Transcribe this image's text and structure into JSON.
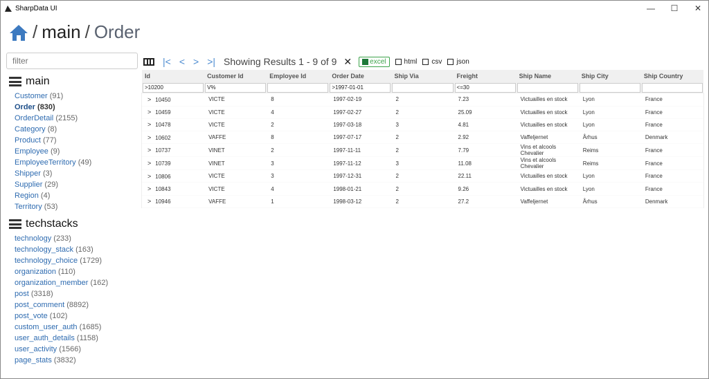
{
  "app": {
    "title": "SharpData UI"
  },
  "breadcrumb": {
    "sep": "/",
    "db": "main",
    "table": "Order"
  },
  "filter": {
    "placeholder": "filter",
    "value": ""
  },
  "sidebar": [
    {
      "name": "main",
      "items": [
        {
          "label": "Customer",
          "count": "(91)"
        },
        {
          "label": "Order",
          "count": "(830)",
          "active": true
        },
        {
          "label": "OrderDetail",
          "count": "(2155)"
        },
        {
          "label": "Category",
          "count": "(8)"
        },
        {
          "label": "Product",
          "count": "(77)"
        },
        {
          "label": "Employee",
          "count": "(9)"
        },
        {
          "label": "EmployeeTerritory",
          "count": "(49)"
        },
        {
          "label": "Shipper",
          "count": "(3)"
        },
        {
          "label": "Supplier",
          "count": "(29)"
        },
        {
          "label": "Region",
          "count": "(4)"
        },
        {
          "label": "Territory",
          "count": "(53)"
        }
      ]
    },
    {
      "name": "techstacks",
      "items": [
        {
          "label": "technology",
          "count": "(233)"
        },
        {
          "label": "technology_stack",
          "count": "(163)"
        },
        {
          "label": "technology_choice",
          "count": "(1729)"
        },
        {
          "label": "organization",
          "count": "(110)"
        },
        {
          "label": "organization_member",
          "count": "(162)"
        },
        {
          "label": "post",
          "count": "(3318)"
        },
        {
          "label": "post_comment",
          "count": "(8892)"
        },
        {
          "label": "post_vote",
          "count": "(102)"
        },
        {
          "label": "custom_user_auth",
          "count": "(1685)"
        },
        {
          "label": "user_auth_details",
          "count": "(1158)"
        },
        {
          "label": "user_activity",
          "count": "(1566)"
        },
        {
          "label": "page_stats",
          "count": "(3832)"
        }
      ]
    }
  ],
  "toolbar": {
    "first": "|<",
    "prev": "<",
    "next": ">",
    "last": ">|",
    "showing": "Showing Results 1 - 9 of 9",
    "clear": "✕",
    "excel": "excel",
    "html": "html",
    "csv": "csv",
    "json": "json"
  },
  "table": {
    "columns": [
      "Id",
      "Customer Id",
      "Employee Id",
      "Order Date",
      "Ship Via",
      "Freight",
      "Ship Name",
      "Ship City",
      "Ship Country"
    ],
    "filters": [
      ">10200",
      "V%",
      "",
      ">1997-01-01",
      "",
      "<=30",
      "",
      "",
      ""
    ],
    "rows": [
      [
        "10450",
        "VICTE",
        "8",
        "1997-02-19",
        "2",
        "7.23",
        "Victuailles en stock",
        "Lyon",
        "France"
      ],
      [
        "10459",
        "VICTE",
        "4",
        "1997-02-27",
        "2",
        "25.09",
        "Victuailles en stock",
        "Lyon",
        "France"
      ],
      [
        "10478",
        "VICTE",
        "2",
        "1997-03-18",
        "3",
        "4.81",
        "Victuailles en stock",
        "Lyon",
        "France"
      ],
      [
        "10602",
        "VAFFE",
        "8",
        "1997-07-17",
        "2",
        "2.92",
        "Vaffeljernet",
        "Århus",
        "Denmark"
      ],
      [
        "10737",
        "VINET",
        "2",
        "1997-11-11",
        "2",
        "7.79",
        "Vins et alcools Chevalier",
        "Reims",
        "France"
      ],
      [
        "10739",
        "VINET",
        "3",
        "1997-11-12",
        "3",
        "11.08",
        "Vins et alcools Chevalier",
        "Reims",
        "France"
      ],
      [
        "10806",
        "VICTE",
        "3",
        "1997-12-31",
        "2",
        "22.11",
        "Victuailles en stock",
        "Lyon",
        "France"
      ],
      [
        "10843",
        "VICTE",
        "4",
        "1998-01-21",
        "2",
        "9.26",
        "Victuailles en stock",
        "Lyon",
        "France"
      ],
      [
        "10946",
        "VAFFE",
        "1",
        "1998-03-12",
        "2",
        "27.2",
        "Vaffeljernet",
        "Århus",
        "Denmark"
      ]
    ]
  }
}
